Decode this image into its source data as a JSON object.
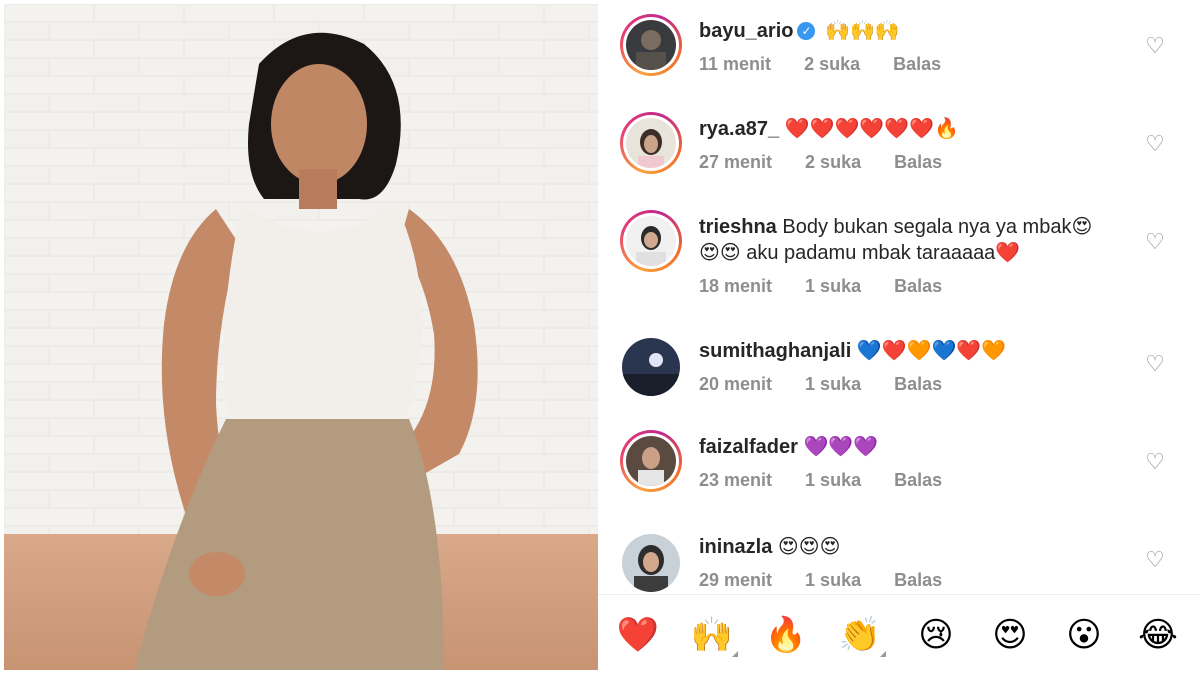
{
  "photo": {
    "description_icon": "woman-portrait"
  },
  "comments": [
    {
      "username": "bayu_ario",
      "verified": true,
      "text": "🙌🙌🙌",
      "time": "11 menit",
      "likes": "2 suka",
      "reply": "Balas",
      "story_ring": true
    },
    {
      "username": "rya.a87_",
      "verified": false,
      "text": "❤️❤️❤️❤️❤️❤️🔥",
      "time": "27 menit",
      "likes": "2 suka",
      "reply": "Balas",
      "story_ring": true
    },
    {
      "username": "trieshna",
      "verified": false,
      "text": "Body bukan segala nya ya mbak😍",
      "text2": "😍😍 aku padamu mbak taraaaaa❤️",
      "time": "18 menit",
      "likes": "1 suka",
      "reply": "Balas",
      "story_ring": true
    },
    {
      "username": "sumithaghanjali",
      "verified": false,
      "text": "💙❤️🧡💙❤️🧡",
      "time": "20 menit",
      "likes": "1 suka",
      "reply": "Balas",
      "story_ring": false
    },
    {
      "username": "faizalfader",
      "verified": false,
      "text": "💜💜💜",
      "time": "23 menit",
      "likes": "1 suka",
      "reply": "Balas",
      "story_ring": true
    },
    {
      "username": "ininazla",
      "verified": false,
      "text": "😍😍😍",
      "time": "29 menit",
      "likes": "1 suka",
      "reply": "Balas",
      "story_ring": false
    }
  ],
  "reactions": [
    "❤️",
    "🙌",
    "🔥",
    "👏",
    "😢",
    "😍",
    "😮",
    "😂"
  ]
}
